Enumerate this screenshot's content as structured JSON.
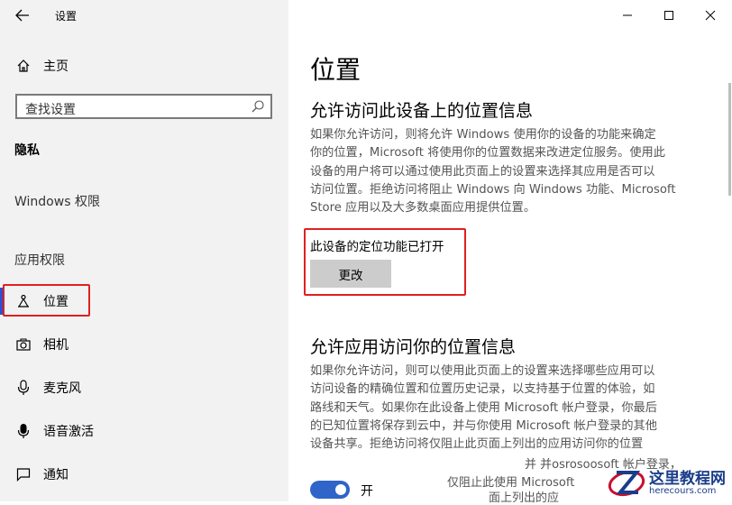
{
  "sidebar": {
    "title": "设置",
    "home": "主页",
    "search_placeholder": "查找设置",
    "section_privacy": "隐私",
    "section_windows_perms": "Windows 权限",
    "section_app_perms": "应用权限",
    "items": [
      {
        "label": "位置",
        "icon": "location-icon",
        "active": true
      },
      {
        "label": "相机",
        "icon": "camera-icon"
      },
      {
        "label": "麦克风",
        "icon": "microphone-icon"
      },
      {
        "label": "语音激活",
        "icon": "voice-activation-icon"
      },
      {
        "label": "通知",
        "icon": "notification-icon"
      }
    ]
  },
  "window": {
    "minimize_icon": "minimize-icon",
    "maximize_icon": "maximize-icon",
    "close_icon": "close-icon"
  },
  "main": {
    "title": "位置",
    "device_section": {
      "heading": "允许访问此设备上的位置信息",
      "lines": [
        "如果你允许访问，则将允许 Windows 使用你的设备的功能来确定",
        "你的位置，Microsoft 将使用你的位置数据来改进定位服务。使用此",
        "设备的用户将可以通过使用此页面上的设置来选择其应用是否可以",
        "访问位置。拒绝访问将阻止 Windows 向 Windows 功能、Microsoft",
        "Store 应用以及大多数桌面应用提供位置。"
      ],
      "status": "此设备的定位功能已打开",
      "change_button": "更改"
    },
    "app_section": {
      "heading": "允许应用访问你的位置信息",
      "lines": [
        "如果你允许访问，则可以使用此页面上的设置来选择哪些应用可以",
        "访问设备的精确位置和位置历史记录，以支持基于位置的体验，如",
        "路线和天气。如果你在此设备上使用 Microsoft 帐户登录，你最后",
        "的已知位置将保存到云中，并与你使用 Microsoft 帐户登录的其他",
        "设备共享。拒绝访问将仅阻止此页面上列出的应用访问你的位置"
      ],
      "overlap_1": "并 并osrosoosoft 帐户登录，",
      "overlap_2": "仅阻止此使用 Microsoft",
      "overlap_3": "面上列出的应",
      "toggle_label": "开",
      "toggle_on": true
    }
  },
  "watermark": {
    "name": "这里教程网",
    "url": "herecours.com"
  },
  "colors": {
    "accent": "#2f64c9",
    "highlight_box": "#e02020",
    "sidebar_bg": "#f2f2f2"
  }
}
